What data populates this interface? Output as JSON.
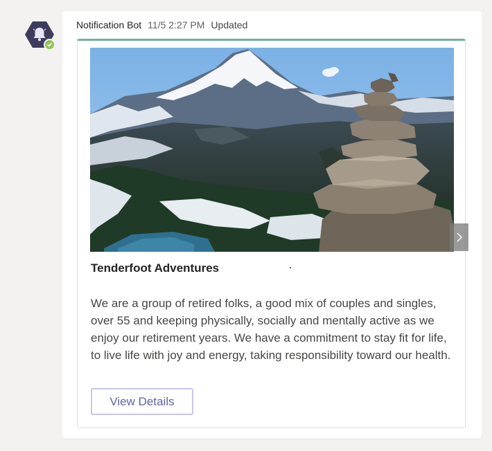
{
  "sender": {
    "name": "Notification Bot",
    "timestamp": "11/5 2:27 PM",
    "edited_label": "Updated",
    "avatar_icon": "bell-icon",
    "presence_icon": "available-check-icon",
    "presence_color": "#92c353",
    "avatar_color": "#3d3c5c"
  },
  "card": {
    "accent_color": "#6db19c",
    "image_alt": "Mountain landscape with stone cairn",
    "title": "Tenderfoot Adventures",
    "description": "We are a group of retired folks, a good mix of couples and singles, over 55 and keeping physically, socially and mentally active as we enjoy our retirement years. We have a commitment to stay fit for life, to live life with joy and energy, taking responsibility toward our health.",
    "action_label": "View Details",
    "next_icon": "chevron-right-icon"
  }
}
